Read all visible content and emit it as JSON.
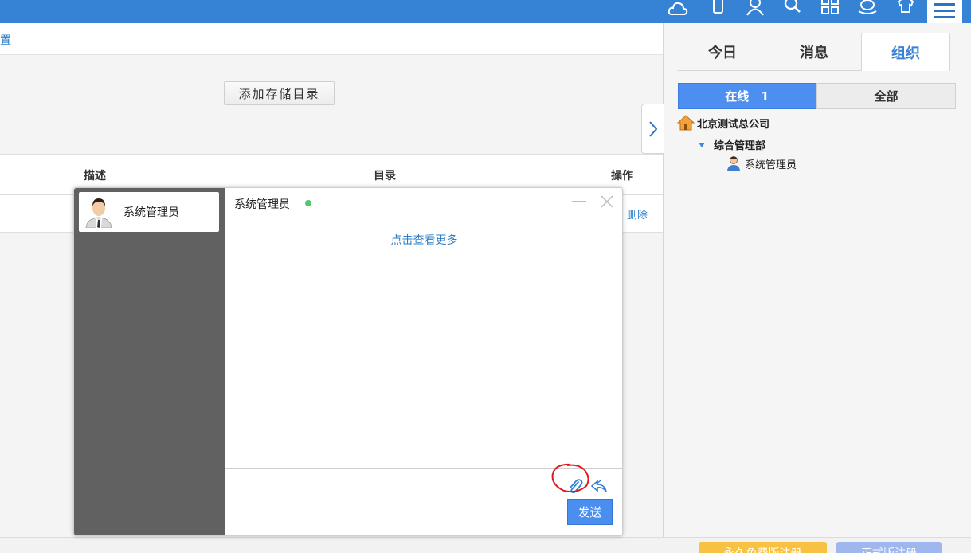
{
  "topbar": {
    "icons": [
      "cloud-icon",
      "mobile-icon",
      "user-icon",
      "search-icon",
      "grid-icon",
      "hat-icon",
      "shirt-icon"
    ],
    "menu_icon": "hamburger-menu-icon",
    "color": "#3683d6"
  },
  "page": {
    "breadcrumb_tail": "置",
    "add_dir_button": "添加存储目录",
    "table_headers": [
      "描述",
      "目录",
      "操作"
    ],
    "row_action": "删除"
  },
  "right_panel": {
    "tabs": [
      "今日",
      "消息",
      "组织"
    ],
    "active_tab": "组织",
    "online_label": "在线　1",
    "all_label": "全部",
    "tree": {
      "company": "北京测试总公司",
      "department": "综合管理部",
      "user": "系统管理员"
    }
  },
  "chat": {
    "contact_name": "系统管理员",
    "title": "系统管理员",
    "status": "online",
    "view_more": "点击查看更多",
    "send_label": "发送",
    "input_value": ""
  },
  "bottom": {
    "buttons": [
      "永久免费版注册",
      "正式版注册"
    ]
  },
  "colors": {
    "accent": "#4a8ef0",
    "link": "#2a7dc7",
    "online_dot": "#4fc96b",
    "chat_sidebar": "#616161"
  }
}
